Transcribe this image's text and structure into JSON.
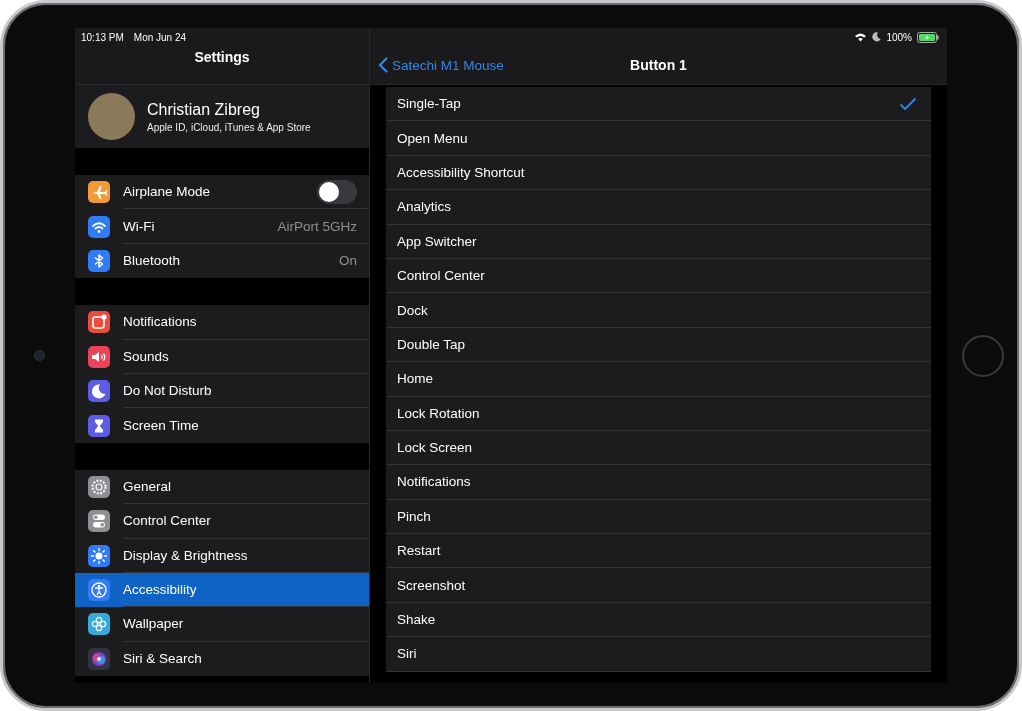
{
  "status_bar": {
    "time": "10:13 PM",
    "date": "Mon Jun 24",
    "battery": "100%"
  },
  "sidebar": {
    "title": "Settings",
    "profile": {
      "name": "Christian Zibreg",
      "subtitle": "Apple ID, iCloud, iTunes & App Store"
    },
    "groups": [
      [
        {
          "label": "Airplane Mode",
          "kind": "toggle",
          "on": false,
          "color": "#f19a37",
          "selected": false
        },
        {
          "label": "Wi-Fi",
          "kind": "value",
          "value": "AirPort 5GHz",
          "color": "#2f7cf6",
          "selected": false
        },
        {
          "label": "Bluetooth",
          "kind": "value",
          "value": "On",
          "color": "#2f7cf6",
          "selected": false
        }
      ],
      [
        {
          "label": "Notifications",
          "kind": "plain",
          "color": "#eb4d3d",
          "selected": false
        },
        {
          "label": "Sounds",
          "kind": "plain",
          "color": "#eb445a",
          "selected": false
        },
        {
          "label": "Do Not Disturb",
          "kind": "plain",
          "color": "#5e5ce6",
          "selected": false
        },
        {
          "label": "Screen Time",
          "kind": "plain",
          "color": "#5e5ce6",
          "selected": false
        }
      ],
      [
        {
          "label": "General",
          "kind": "plain",
          "color": "#8e8e93",
          "selected": false
        },
        {
          "label": "Control Center",
          "kind": "plain",
          "color": "#8e8e93",
          "selected": false
        },
        {
          "label": "Display & Brightness",
          "kind": "plain",
          "color": "#2f7cf6",
          "selected": false
        },
        {
          "label": "Accessibility",
          "kind": "plain",
          "color": "#2f7cf6",
          "selected": true
        },
        {
          "label": "Wallpaper",
          "kind": "plain",
          "color": "#35aadc",
          "selected": false
        },
        {
          "label": "Siri & Search",
          "kind": "plain",
          "color": "#333344",
          "selected": false
        }
      ]
    ]
  },
  "detail": {
    "back": "Satechi M1 Mouse",
    "title": "Button 1",
    "options": [
      {
        "label": "Single-Tap",
        "selected": true
      },
      {
        "label": "Open Menu",
        "selected": false
      },
      {
        "label": "Accessibility Shortcut",
        "selected": false
      },
      {
        "label": "Analytics",
        "selected": false
      },
      {
        "label": "App Switcher",
        "selected": false
      },
      {
        "label": "Control Center",
        "selected": false
      },
      {
        "label": "Dock",
        "selected": false
      },
      {
        "label": "Double Tap",
        "selected": false
      },
      {
        "label": "Home",
        "selected": false
      },
      {
        "label": "Lock Rotation",
        "selected": false
      },
      {
        "label": "Lock Screen",
        "selected": false
      },
      {
        "label": "Notifications",
        "selected": false
      },
      {
        "label": "Pinch",
        "selected": false
      },
      {
        "label": "Restart",
        "selected": false
      },
      {
        "label": "Screenshot",
        "selected": false
      },
      {
        "label": "Shake",
        "selected": false
      },
      {
        "label": "Siri",
        "selected": false
      }
    ]
  }
}
